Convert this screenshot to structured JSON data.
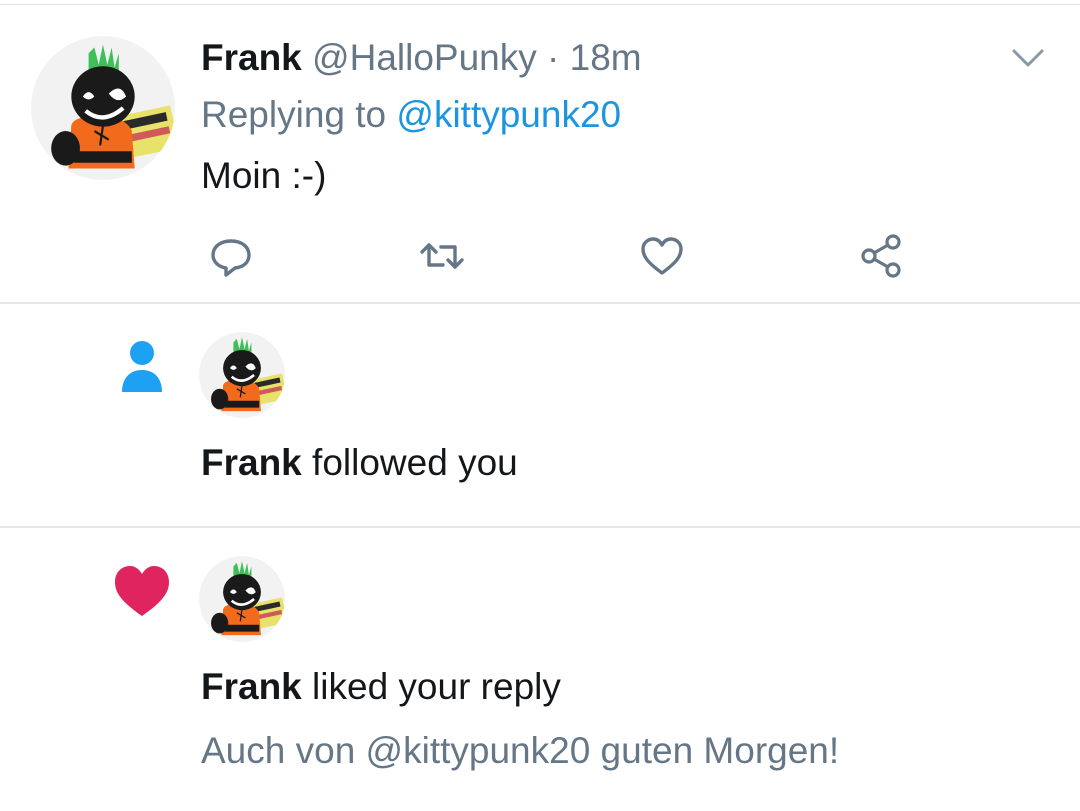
{
  "tweet": {
    "author_name": "Frank",
    "author_handle": "@HalloPunky",
    "separator": "·",
    "time": "18m",
    "replying_prefix": "Replying to",
    "replying_to": "@kittypunk20",
    "text": "Moin :-)"
  },
  "notifications": [
    {
      "type": "follow",
      "icon": "person-icon",
      "actor": "Frank",
      "action": "followed you",
      "color": "#1da1f2"
    },
    {
      "type": "like",
      "icon": "heart-icon",
      "actor": "Frank",
      "action": "liked your reply",
      "snippet": "Auch von @kittypunk20 guten Morgen!",
      "color": "#e0245e"
    }
  ],
  "colors": {
    "text": "#14171a",
    "muted": "#657786",
    "link": "#1b95e0",
    "divider": "#e1e8ed",
    "follow_blue": "#1da1f2",
    "like_red": "#e0245e",
    "avatar_mohawk": "#3fbf5a",
    "avatar_shirt": "#f26a1b"
  }
}
